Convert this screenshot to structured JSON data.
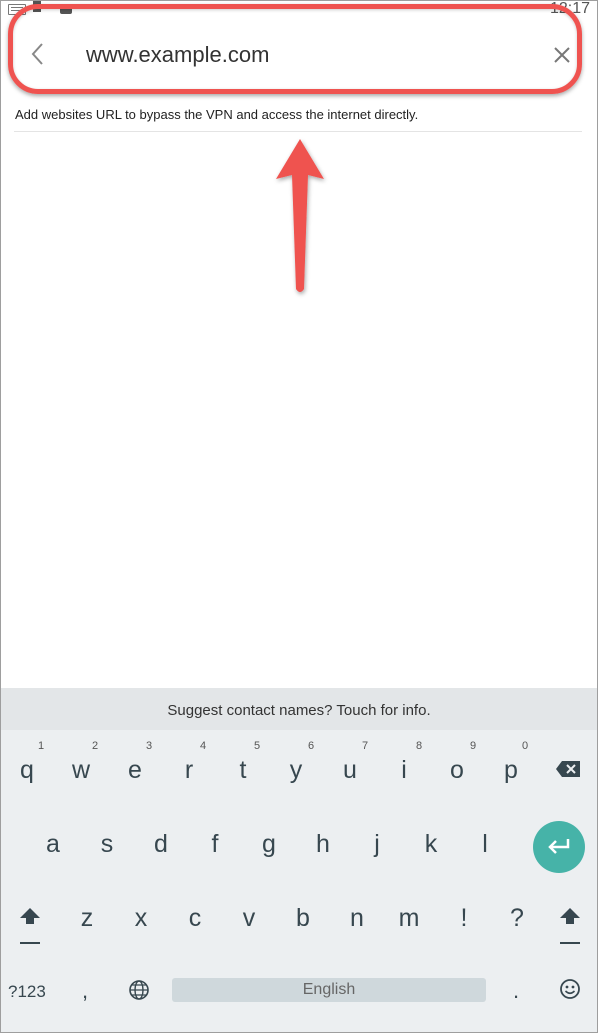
{
  "status_bar": {
    "time": "12:17"
  },
  "search": {
    "value": "www.example.com",
    "hint": "Add websites URL to bypass the VPN and access the internet directly."
  },
  "keyboard": {
    "suggestion": "Suggest contact names? Touch for info.",
    "row1": [
      {
        "key": "q",
        "num": "1"
      },
      {
        "key": "w",
        "num": "2"
      },
      {
        "key": "e",
        "num": "3"
      },
      {
        "key": "r",
        "num": "4"
      },
      {
        "key": "t",
        "num": "5"
      },
      {
        "key": "y",
        "num": "6"
      },
      {
        "key": "u",
        "num": "7"
      },
      {
        "key": "i",
        "num": "8"
      },
      {
        "key": "o",
        "num": "9"
      },
      {
        "key": "p",
        "num": "0"
      }
    ],
    "row2": [
      "a",
      "s",
      "d",
      "f",
      "g",
      "h",
      "j",
      "k",
      "l"
    ],
    "row3": [
      "z",
      "x",
      "c",
      "v",
      "b",
      "n",
      "m",
      "!",
      "?"
    ],
    "mode_label": "?123",
    "comma": ",",
    "space_label": "English",
    "period": "."
  },
  "colors": {
    "annotation": "#ef5350",
    "enter_key": "#46b3a8"
  }
}
